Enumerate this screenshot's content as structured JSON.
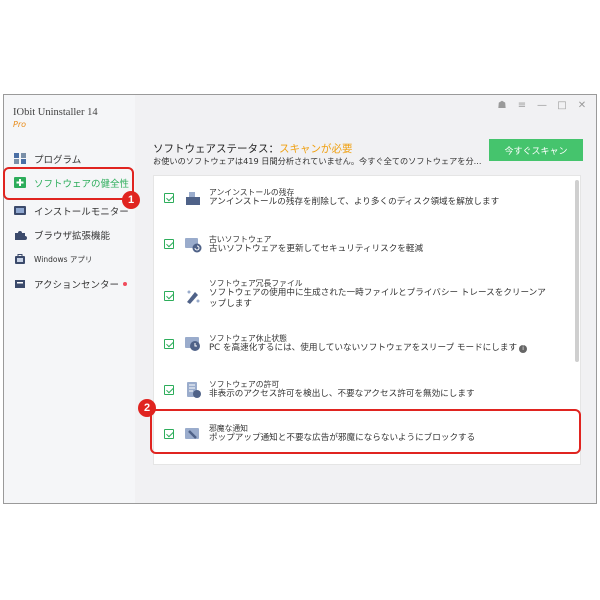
{
  "app": {
    "title": "IObit Uninstaller 14",
    "edition": "Pro"
  },
  "sidebar": {
    "items": [
      {
        "label": "プログラム",
        "icon": "grid-icon"
      },
      {
        "label": "ソフトウェアの健全性",
        "icon": "health-icon"
      },
      {
        "label": "インストールモニター",
        "icon": "monitor-icon"
      },
      {
        "label": "ブラウザ拡張機能",
        "icon": "puzzle-icon"
      },
      {
        "label": "Windows アプリ",
        "icon": "windows-store-icon"
      },
      {
        "label": "アクションセンター",
        "icon": "flag-icon"
      }
    ]
  },
  "window_controls": [
    "☗",
    "≡",
    "—",
    "□",
    "✕"
  ],
  "main": {
    "status_label": "ソフトウェアステータス：",
    "status_value": "スキャンが必要",
    "description": "お使いのソフトウェアは419 日間分析されていません。今すぐ全てのソフトウェアを分...",
    "scan_button": "今すぐスキャン",
    "rows": [
      {
        "title": "アンインストールの残存",
        "desc": "アンインストールの残存を削除して、より多くのディスク領域を解放します",
        "icon": "broom-icon"
      },
      {
        "title": "古いソフトウェア",
        "desc": "古いソフトウェアを更新してセキュリティリスクを軽減",
        "icon": "update-icon"
      },
      {
        "title": "ソフトウェア冗長ファイル",
        "desc": "ソフトウェアの使用中に生成された一時ファイルとプライバシー トレースをクリーンアップします",
        "icon": "clean-icon"
      },
      {
        "title": "ソフトウェア休止状態",
        "desc": "PC を高速化するには、使用していないソフトウェアをスリープ モードにします",
        "icon": "sleep-icon"
      },
      {
        "title": "ソフトウェアの許可",
        "desc": "非表示のアクセス許可を検出し、不要なアクセス許可を無効にします",
        "icon": "permission-icon"
      },
      {
        "title": "邪魔な通知",
        "desc": "ポップアップ通知と不要な広告が邪魔にならないようにブロックする",
        "icon": "notification-block-icon"
      }
    ]
  },
  "callouts": [
    "1",
    "2"
  ],
  "colors": {
    "accent_green": "#45c46d",
    "status_orange": "#f0a011",
    "callout_red": "#e02420"
  }
}
